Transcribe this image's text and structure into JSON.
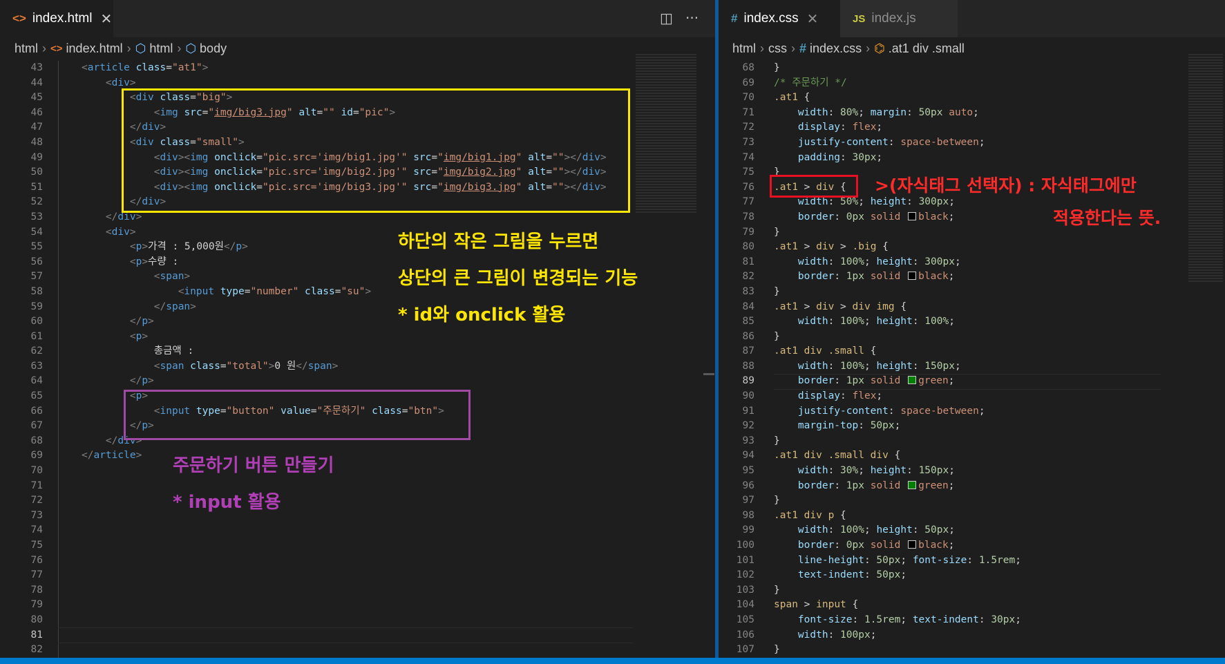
{
  "left_pane": {
    "tab": {
      "name": "index.html",
      "icon": "<>"
    },
    "actions": {
      "split": "◫",
      "more": "···"
    },
    "breadcrumb": [
      "html",
      "index.html",
      "html",
      "body"
    ],
    "line_numbers": [
      "43",
      "44",
      "45",
      "46",
      "47",
      "48",
      "49",
      "50",
      "51",
      "52",
      "53",
      "54",
      "55",
      "56",
      "57",
      "58",
      "59",
      "60",
      "61",
      "62",
      "63",
      "64",
      "65",
      "66",
      "67",
      "68",
      "69",
      "70",
      "71",
      "72",
      "73",
      "74",
      "75",
      "76",
      "77",
      "78",
      "79",
      "80",
      "81",
      "82"
    ],
    "current_line": "81",
    "annotation_yellow": {
      "line1": "하단의 작은 그림을 누르면",
      "line2": "상단의 큰 그림이 변경되는 기능",
      "line3": "* id와 onclick 활용"
    },
    "annotation_purple": {
      "line1": "주문하기 버튼 만들기",
      "line2": "* input 활용"
    }
  },
  "right_pane": {
    "tabs": [
      {
        "name": "index.css",
        "icon": "#"
      },
      {
        "name": "index.js",
        "icon": "JS"
      }
    ],
    "breadcrumb": [
      "html",
      "css",
      "index.css",
      ".at1 div .small"
    ],
    "line_numbers": [
      "68",
      "69",
      "70",
      "71",
      "72",
      "73",
      "74",
      "75",
      "76",
      "77",
      "78",
      "79",
      "80",
      "81",
      "82",
      "83",
      "84",
      "85",
      "86",
      "87",
      "88",
      "89",
      "90",
      "91",
      "92",
      "93",
      "94",
      "95",
      "96",
      "97",
      "98",
      "99",
      "100",
      "101",
      "102",
      "103",
      "104",
      "105",
      "106",
      "107"
    ],
    "current_line": "89",
    "annotation_red": {
      "line1": ">(자식태그 선택자) : 자식태그에만",
      "line2": "적용한다는 뜻."
    }
  },
  "colors": {
    "accent": "#007acc",
    "yellow_box": "#ffe600",
    "purple_box": "#a04aa3",
    "red_box": "#e81123",
    "green_swatch": "#008000"
  }
}
